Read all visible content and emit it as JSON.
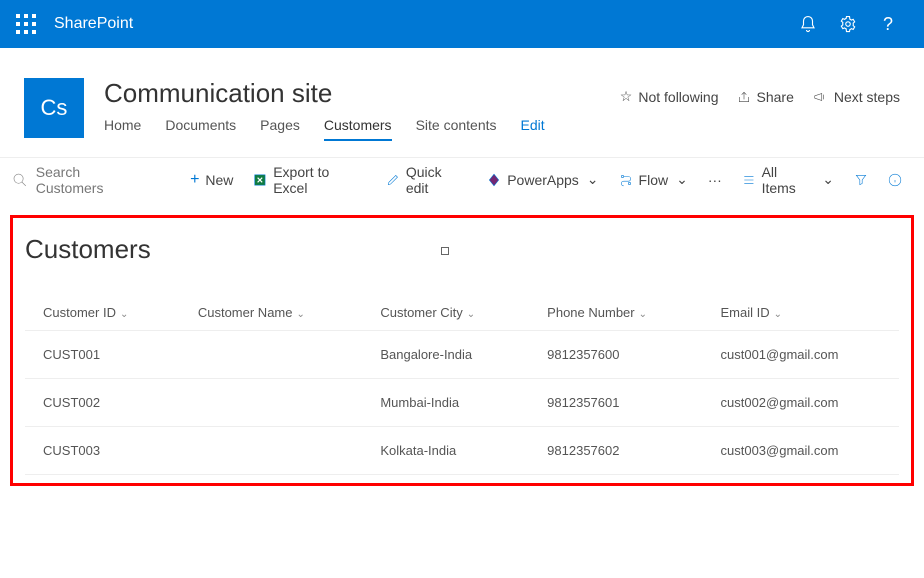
{
  "topbar": {
    "brand": "SharePoint"
  },
  "site": {
    "logo_text": "Cs",
    "title": "Communication site"
  },
  "nav": {
    "home": "Home",
    "documents": "Documents",
    "pages": "Pages",
    "customers": "Customers",
    "site_contents": "Site contents",
    "edit": "Edit"
  },
  "header_actions": {
    "follow": "Not following",
    "share": "Share",
    "next_steps": "Next steps"
  },
  "cmdbar": {
    "search_placeholder": "Search Customers",
    "new": "New",
    "export": "Export to Excel",
    "quick_edit": "Quick edit",
    "powerapps": "PowerApps",
    "flow": "Flow",
    "all_items": "All Items"
  },
  "list": {
    "title": "Customers"
  },
  "columns": {
    "id": "Customer ID",
    "name": "Customer Name",
    "city": "Customer City",
    "phone": "Phone Number",
    "email": "Email ID"
  },
  "rows": [
    {
      "id": "CUST001",
      "name": "",
      "city": "Bangalore-India",
      "phone": "9812357600",
      "email": "cust001@gmail.com"
    },
    {
      "id": "CUST002",
      "name": "",
      "city": "Mumbai-India",
      "phone": "9812357601",
      "email": "cust002@gmail.com"
    },
    {
      "id": "CUST003",
      "name": "",
      "city": "Kolkata-India",
      "phone": "9812357602",
      "email": "cust003@gmail.com"
    }
  ]
}
